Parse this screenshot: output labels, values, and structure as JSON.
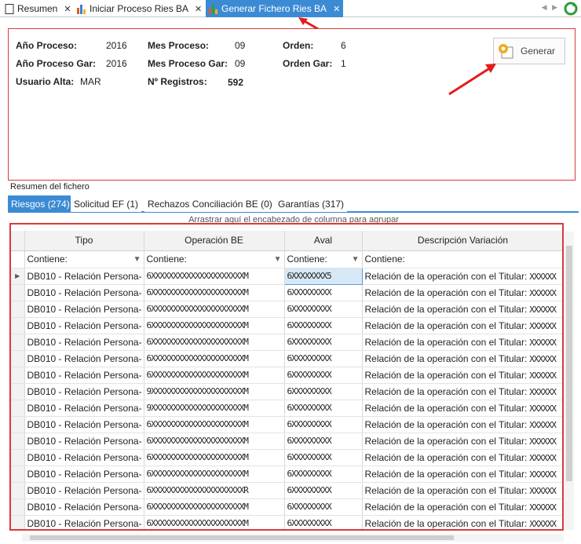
{
  "doc_tabs": [
    {
      "label": "Resumen",
      "icon": "document-icon"
    },
    {
      "label": "Iniciar Proceso Ries BA",
      "icon": "bar-chart-icon"
    },
    {
      "label": "Generar Fichero Ries BA",
      "icon": "bar-chart-icon",
      "active": true
    }
  ],
  "close_glyph": "✕",
  "header": {
    "anio_proceso_label": "Año Proceso:",
    "anio_proceso_value": "2016",
    "mes_proceso_label": "Mes Proceso:",
    "mes_proceso_value": "09",
    "orden_label": "Orden:",
    "orden_value": "6",
    "anio_proceso_gar_label": "Año Proceso Gar:",
    "anio_proceso_gar_value": "2016",
    "mes_proceso_gar_label": "Mes Proceso Gar:",
    "mes_proceso_gar_value": "09",
    "orden_gar_label": "Orden Gar:",
    "orden_gar_value": "1",
    "usuario_alta_label": "Usuario Alta:",
    "usuario_alta_value": "MAR",
    "n_registros_label": "Nº Registros:",
    "n_registros_value": "592",
    "generar_label": "Generar"
  },
  "resumen_label": "Resumen del fichero",
  "inner_tabs": [
    {
      "label": "Riesgos (274)",
      "active": true
    },
    {
      "label": "Solicitud EF (1)"
    },
    {
      "label": "Rechazos Conciliación BE (0)"
    },
    {
      "label": "Garantías (317)"
    }
  ],
  "group_panel_text": "Arrastrar aquí el encabezado de columna para agrupar",
  "grid": {
    "columns": [
      "Tipo",
      "Operación BE",
      "Aval",
      "Descripción Variación"
    ],
    "filter_text": "Contiene:",
    "tipo_value": "DB010 - Relación Persona-",
    "desc_value": "Relación de la operación con el Titular:",
    "rows": [
      {
        "op": "6XXXXXXXXXXXXXXXXXXXXXM",
        "aval": "6XXXXXXXX5",
        "desc_tail": "XXXXXX"
      },
      {
        "op": "6XXXXXXXXXXXXXXXXXXXXXM",
        "aval": "6XXXXXXXXX",
        "desc_tail": "XXXXXX"
      },
      {
        "op": "6XXXXXXXXXXXXXXXXXXXXXM",
        "aval": "6XXXXXXXXX",
        "desc_tail": "XXXXXX"
      },
      {
        "op": "6XXXXXXXXXXXXXXXXXXXXXM",
        "aval": "6XXXXXXXXX",
        "desc_tail": "XXXXXX"
      },
      {
        "op": "6XXXXXXXXXXXXXXXXXXXXXM",
        "aval": "6XXXXXXXXX",
        "desc_tail": "XXXXXX"
      },
      {
        "op": "6XXXXXXXXXXXXXXXXXXXXXM",
        "aval": "6XXXXXXXXX",
        "desc_tail": "XXXXXX"
      },
      {
        "op": "6XXXXXXXXXXXXXXXXXXXXXM",
        "aval": "6XXXXXXXXX",
        "desc_tail": "XXXXXX"
      },
      {
        "op": "9XXXXXXXXXXXXXXXXXXXXXM",
        "aval": "6XXXXXXXXX",
        "desc_tail": "XXXXXX"
      },
      {
        "op": "9XXXXXXXXXXXXXXXXXXXXXM",
        "aval": "6XXXXXXXXX",
        "desc_tail": "XXXXXX"
      },
      {
        "op": "6XXXXXXXXXXXXXXXXXXXXXM",
        "aval": "6XXXXXXXXX",
        "desc_tail": "XXXXXX"
      },
      {
        "op": "6XXXXXXXXXXXXXXXXXXXXXM",
        "aval": "6XXXXXXXXX",
        "desc_tail": "XXXXXX"
      },
      {
        "op": "6XXXXXXXXXXXXXXXXXXXXXM",
        "aval": "6XXXXXXXXX",
        "desc_tail": "XXXXXX"
      },
      {
        "op": "6XXXXXXXXXXXXXXXXXXXXXM",
        "aval": "6XXXXXXXXX",
        "desc_tail": "XXXXXX"
      },
      {
        "op": "6XXXXXXXXXXXXXXXXXXXXXR",
        "aval": "6XXXXXXXXX",
        "desc_tail": "XXXXXX"
      },
      {
        "op": "6XXXXXXXXXXXXXXXXXXXXXM",
        "aval": "6XXXXXXXXX",
        "desc_tail": "XXXXXX"
      },
      {
        "op": "6XXXXXXXXXXXXXXXXXXXXXM",
        "aval": "6XXXXXXXXX",
        "desc_tail": "XXXXXX"
      }
    ]
  },
  "colors": {
    "accent": "#3b8bd4",
    "annotation": "#d93a3a"
  }
}
